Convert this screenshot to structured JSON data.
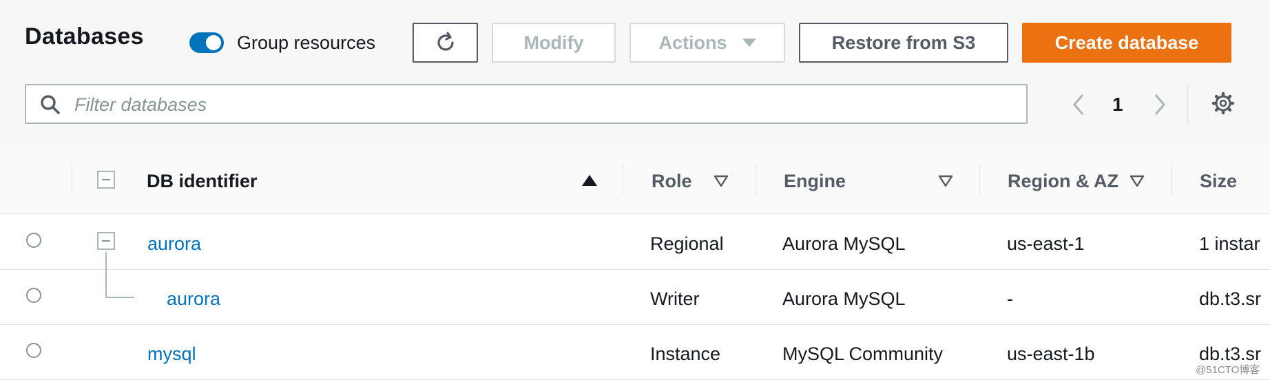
{
  "header": {
    "title": "Databases",
    "group_resources_label": "Group resources",
    "buttons": {
      "modify": "Modify",
      "actions": "Actions",
      "restore": "Restore from S3",
      "create": "Create database"
    }
  },
  "search": {
    "placeholder": "Filter databases",
    "value": ""
  },
  "pagination": {
    "current_page": "1"
  },
  "table": {
    "columns": {
      "identifier": "DB identifier",
      "role": "Role",
      "engine": "Engine",
      "region": "Region & AZ",
      "size": "Size"
    },
    "rows": [
      {
        "identifier": "aurora",
        "role": "Regional",
        "engine": "Aurora MySQL",
        "region": "us-east-1",
        "size": "1 instar"
      },
      {
        "identifier": "aurora",
        "role": "Writer",
        "engine": "Aurora MySQL",
        "region": "-",
        "size": "db.t3.sr"
      },
      {
        "identifier": "mysql",
        "role": "Instance",
        "engine": "MySQL Community",
        "region": "us-east-1b",
        "size": "db.t3.sr"
      }
    ]
  },
  "watermark": "@51CTO博客",
  "colors": {
    "accent": "#0073bb",
    "primary_button": "#ec7211"
  }
}
